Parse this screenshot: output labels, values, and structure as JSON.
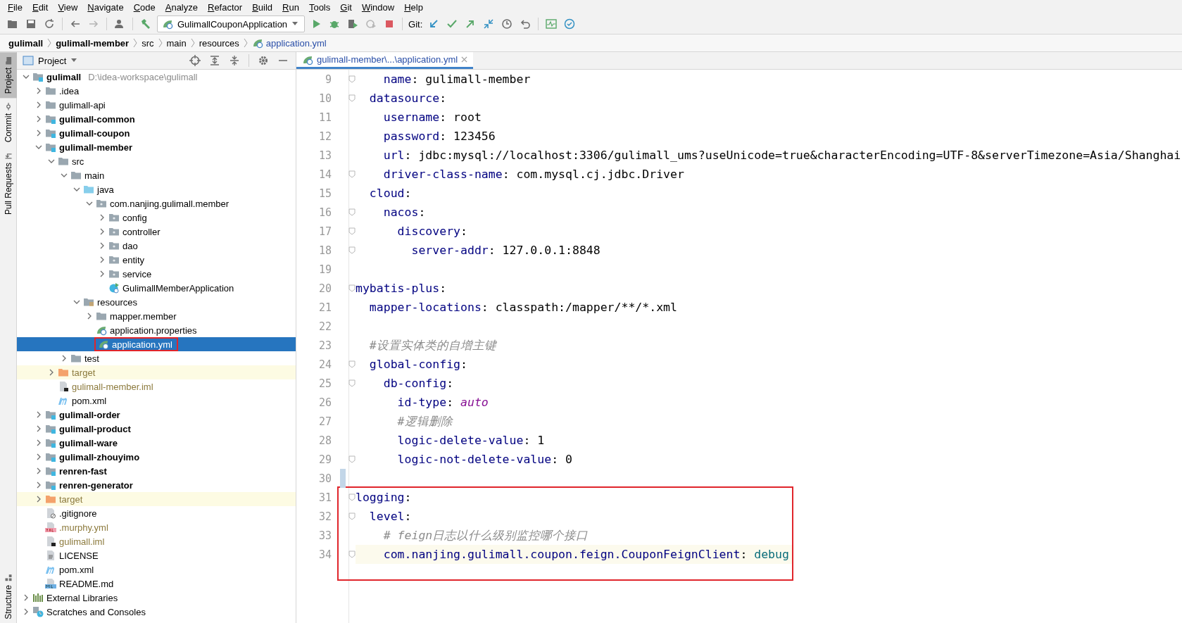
{
  "menu": [
    "File",
    "Edit",
    "View",
    "Navigate",
    "Code",
    "Analyze",
    "Refactor",
    "Build",
    "Run",
    "Tools",
    "Git",
    "Window",
    "Help"
  ],
  "toolbar": {
    "run_config": "GulimallCouponApplication",
    "git_label": "Git:"
  },
  "breadcrumbs": [
    {
      "label": "gulimall",
      "kind": "project"
    },
    {
      "label": "gulimall-member",
      "kind": "project"
    },
    {
      "label": "src",
      "kind": "dir"
    },
    {
      "label": "main",
      "kind": "dir"
    },
    {
      "label": "resources",
      "kind": "dir"
    },
    {
      "label": "application.yml",
      "kind": "file"
    }
  ],
  "side_tabs": [
    {
      "label": "Project",
      "selected": true,
      "kind": "folder"
    },
    {
      "label": "Commit",
      "selected": false,
      "kind": "commit"
    },
    {
      "label": "Pull Requests",
      "selected": false,
      "kind": "pull"
    },
    {
      "label": "Structure",
      "selected": false,
      "kind": "structure"
    }
  ],
  "project_panel": {
    "title": "Project",
    "tree": [
      {
        "label": "gulimall",
        "kind": "module",
        "bold": true,
        "path": "D:\\idea-workspace\\gulimall",
        "expanded": true,
        "selected": false,
        "children": [
          {
            "label": ".idea",
            "kind": "folder",
            "bold": false,
            "expanded": false,
            "selected": false
          },
          {
            "label": "gulimall-api",
            "kind": "folder",
            "bold": false,
            "expanded": false,
            "selected": false
          },
          {
            "label": "gulimall-common",
            "kind": "module",
            "bold": true,
            "expanded": false,
            "selected": false
          },
          {
            "label": "gulimall-coupon",
            "kind": "module",
            "bold": true,
            "expanded": false,
            "selected": false
          },
          {
            "label": "gulimall-member",
            "kind": "module",
            "bold": true,
            "expanded": true,
            "selected": false,
            "children": [
              {
                "label": "src",
                "kind": "folder",
                "bold": false,
                "expanded": true,
                "selected": false,
                "children": [
                  {
                    "label": "main",
                    "kind": "folder",
                    "bold": false,
                    "expanded": true,
                    "selected": false,
                    "children": [
                      {
                        "label": "java",
                        "kind": "source-folder",
                        "bold": false,
                        "expanded": true,
                        "selected": false,
                        "children": [
                          {
                            "label": "com.nanjing.gulimall.member",
                            "kind": "package",
                            "bold": false,
                            "expanded": true,
                            "selected": false,
                            "children": [
                              {
                                "label": "config",
                                "kind": "package",
                                "bold": false,
                                "expanded": false,
                                "selected": false
                              },
                              {
                                "label": "controller",
                                "kind": "package",
                                "bold": false,
                                "expanded": false,
                                "selected": false
                              },
                              {
                                "label": "dao",
                                "kind": "package",
                                "bold": false,
                                "expanded": false,
                                "selected": false
                              },
                              {
                                "label": "entity",
                                "kind": "package",
                                "bold": false,
                                "expanded": false,
                                "selected": false
                              },
                              {
                                "label": "service",
                                "kind": "package",
                                "bold": false,
                                "expanded": false,
                                "selected": false
                              },
                              {
                                "label": "GulimallMemberApplication",
                                "kind": "spring-class",
                                "bold": false,
                                "selected": false
                              }
                            ]
                          }
                        ]
                      },
                      {
                        "label": "resources",
                        "kind": "resource-folder",
                        "bold": false,
                        "expanded": true,
                        "selected": false,
                        "children": [
                          {
                            "label": "mapper.member",
                            "kind": "folder",
                            "bold": false,
                            "expanded": false,
                            "selected": false
                          },
                          {
                            "label": "application.properties",
                            "kind": "spring-config",
                            "bold": false,
                            "selected": false
                          },
                          {
                            "label": "application.yml",
                            "kind": "spring-config",
                            "bold": false,
                            "selected": true,
                            "outlined": true
                          }
                        ]
                      }
                    ]
                  },
                  {
                    "label": "test",
                    "kind": "folder",
                    "bold": false,
                    "expanded": false,
                    "selected": false
                  }
                ]
              },
              {
                "label": "target",
                "kind": "excluded-folder",
                "bold": false,
                "expanded": false,
                "selected": false
              },
              {
                "label": "gulimall-member.iml",
                "kind": "iml",
                "bold": false,
                "selected": false
              },
              {
                "label": "pom.xml",
                "kind": "maven",
                "bold": false,
                "selected": false
              }
            ]
          },
          {
            "label": "gulimall-order",
            "kind": "module",
            "bold": true,
            "expanded": false,
            "selected": false
          },
          {
            "label": "gulimall-product",
            "kind": "module",
            "bold": true,
            "expanded": false,
            "selected": false
          },
          {
            "label": "gulimall-ware",
            "kind": "module",
            "bold": true,
            "expanded": false,
            "selected": false
          },
          {
            "label": "gulimall-zhouyimo",
            "kind": "module",
            "bold": true,
            "expanded": false,
            "selected": false
          },
          {
            "label": "renren-fast",
            "kind": "module",
            "bold": true,
            "expanded": false,
            "selected": false
          },
          {
            "label": "renren-generator",
            "kind": "module",
            "bold": true,
            "expanded": false,
            "selected": false
          },
          {
            "label": "target",
            "kind": "excluded-folder",
            "bold": false,
            "expanded": false,
            "selected": false
          },
          {
            "label": ".gitignore",
            "kind": "ignore",
            "bold": false,
            "selected": false
          },
          {
            "label": ".murphy.yml",
            "kind": "yaml",
            "bold": false,
            "selected": false
          },
          {
            "label": "gulimall.iml",
            "kind": "iml",
            "bold": false,
            "selected": false
          },
          {
            "label": "LICENSE",
            "kind": "text",
            "bold": false,
            "selected": false
          },
          {
            "label": "pom.xml",
            "kind": "maven",
            "bold": false,
            "selected": false
          },
          {
            "label": "README.md",
            "kind": "markdown",
            "bold": false,
            "selected": false
          }
        ]
      },
      {
        "label": "External Libraries",
        "kind": "libraries",
        "bold": false,
        "expanded": false,
        "selected": false
      },
      {
        "label": "Scratches and Consoles",
        "kind": "scratches",
        "bold": false,
        "expanded": false,
        "selected": false
      }
    ]
  },
  "editor": {
    "tab": {
      "label": "gulimall-member\\...\\application.yml",
      "selected": true
    },
    "lines": [
      {
        "number": "9",
        "fold": true,
        "changed": false,
        "current": false,
        "tokens": [
          {
            "kind": "key",
            "text": "    name"
          },
          {
            "kind": "plain",
            "text": ": gulimall-member"
          }
        ]
      },
      {
        "number": "10",
        "fold": true,
        "changed": false,
        "current": false,
        "tokens": [
          {
            "kind": "key",
            "text": "  datasource"
          },
          {
            "kind": "plain",
            "text": ":"
          }
        ]
      },
      {
        "number": "11",
        "fold": false,
        "changed": false,
        "current": false,
        "tokens": [
          {
            "kind": "key",
            "text": "    username"
          },
          {
            "kind": "plain",
            "text": ": root"
          }
        ]
      },
      {
        "number": "12",
        "fold": false,
        "changed": false,
        "current": false,
        "tokens": [
          {
            "kind": "key",
            "text": "    password"
          },
          {
            "kind": "plain",
            "text": ": 123456"
          }
        ]
      },
      {
        "number": "13",
        "fold": false,
        "changed": false,
        "current": false,
        "tokens": [
          {
            "kind": "key",
            "text": "    url"
          },
          {
            "kind": "plain",
            "text": ": jdbc:mysql://localhost:3306/gulimall_ums?useUnicode=true&characterEncoding=UTF-8&serverTimezone=Asia/Shanghai"
          }
        ]
      },
      {
        "number": "14",
        "fold": true,
        "changed": false,
        "current": false,
        "tokens": [
          {
            "kind": "key",
            "text": "    driver-class-name"
          },
          {
            "kind": "plain",
            "text": ": com.mysql.cj.jdbc.Driver"
          }
        ]
      },
      {
        "number": "15",
        "fold": false,
        "changed": false,
        "current": false,
        "tokens": [
          {
            "kind": "key",
            "text": "  cloud"
          },
          {
            "kind": "plain",
            "text": ":"
          }
        ]
      },
      {
        "number": "16",
        "fold": true,
        "changed": false,
        "current": false,
        "tokens": [
          {
            "kind": "key",
            "text": "    nacos"
          },
          {
            "kind": "plain",
            "text": ":"
          }
        ]
      },
      {
        "number": "17",
        "fold": true,
        "changed": false,
        "current": false,
        "tokens": [
          {
            "kind": "key",
            "text": "      discovery"
          },
          {
            "kind": "plain",
            "text": ":"
          }
        ]
      },
      {
        "number": "18",
        "fold": true,
        "changed": false,
        "current": false,
        "tokens": [
          {
            "kind": "key",
            "text": "        server-addr"
          },
          {
            "kind": "plain",
            "text": ": 127.0.0.1:8848"
          }
        ]
      },
      {
        "number": "19",
        "fold": false,
        "changed": false,
        "current": false
      },
      {
        "number": "20",
        "fold": true,
        "changed": false,
        "current": false,
        "tokens": [
          {
            "kind": "key",
            "text": "mybatis-plus"
          },
          {
            "kind": "plain",
            "text": ":"
          }
        ]
      },
      {
        "number": "21",
        "fold": false,
        "changed": false,
        "current": false,
        "tokens": [
          {
            "kind": "key",
            "text": "  mapper-locations"
          },
          {
            "kind": "plain",
            "text": ": classpath:/mapper/**/*.xml"
          }
        ]
      },
      {
        "number": "22",
        "fold": false,
        "changed": false,
        "current": false
      },
      {
        "number": "23",
        "fold": false,
        "changed": false,
        "current": false,
        "tokens": [
          {
            "kind": "comment",
            "text": "  #设置实体类的自增主键"
          }
        ]
      },
      {
        "number": "24",
        "fold": true,
        "changed": false,
        "current": false,
        "tokens": [
          {
            "kind": "key",
            "text": "  global-config"
          },
          {
            "kind": "plain",
            "text": ":"
          }
        ]
      },
      {
        "number": "25",
        "fold": true,
        "changed": false,
        "current": false,
        "tokens": [
          {
            "kind": "key",
            "text": "    db-config"
          },
          {
            "kind": "plain",
            "text": ":"
          }
        ]
      },
      {
        "number": "26",
        "fold": false,
        "changed": false,
        "current": false,
        "tokens": [
          {
            "kind": "key",
            "text": "      id-type"
          },
          {
            "kind": "plain",
            "text": ": "
          },
          {
            "kind": "enum",
            "text": "auto"
          }
        ]
      },
      {
        "number": "27",
        "fold": false,
        "changed": false,
        "current": false,
        "tokens": [
          {
            "kind": "comment",
            "text": "      #逻辑删除"
          }
        ]
      },
      {
        "number": "28",
        "fold": false,
        "changed": false,
        "current": false,
        "tokens": [
          {
            "kind": "key",
            "text": "      logic-delete-value"
          },
          {
            "kind": "plain",
            "text": ": 1"
          }
        ]
      },
      {
        "number": "29",
        "fold": true,
        "changed": false,
        "current": false,
        "tokens": [
          {
            "kind": "key",
            "text": "      logic-not-delete-value"
          },
          {
            "kind": "plain",
            "text": ": 0"
          }
        ]
      },
      {
        "number": "30",
        "fold": false,
        "changed": true,
        "current": false
      }
    ],
    "annotated_lines": [
      {
        "number": "31",
        "fold": true,
        "changed": false,
        "current": false,
        "tokens": [
          {
            "kind": "key",
            "text": "logging"
          },
          {
            "kind": "plain",
            "text": ":"
          }
        ]
      },
      {
        "number": "32",
        "fold": true,
        "changed": false,
        "current": false,
        "tokens": [
          {
            "kind": "key",
            "text": "  level"
          },
          {
            "kind": "plain",
            "text": ":"
          }
        ]
      },
      {
        "number": "33",
        "fold": false,
        "changed": false,
        "current": false,
        "tokens": [
          {
            "kind": "comment",
            "text": "    # feign日志以什么级别监控哪个接口"
          }
        ]
      },
      {
        "number": "34",
        "fold": true,
        "changed": false,
        "current": true,
        "tokens": [
          {
            "kind": "key",
            "text": "    com.nanjing.gulimall.coupon.feign.CouponFeignClient"
          },
          {
            "kind": "plain",
            "text": ": "
          },
          {
            "kind": "value",
            "text": "debug"
          }
        ]
      }
    ]
  }
}
